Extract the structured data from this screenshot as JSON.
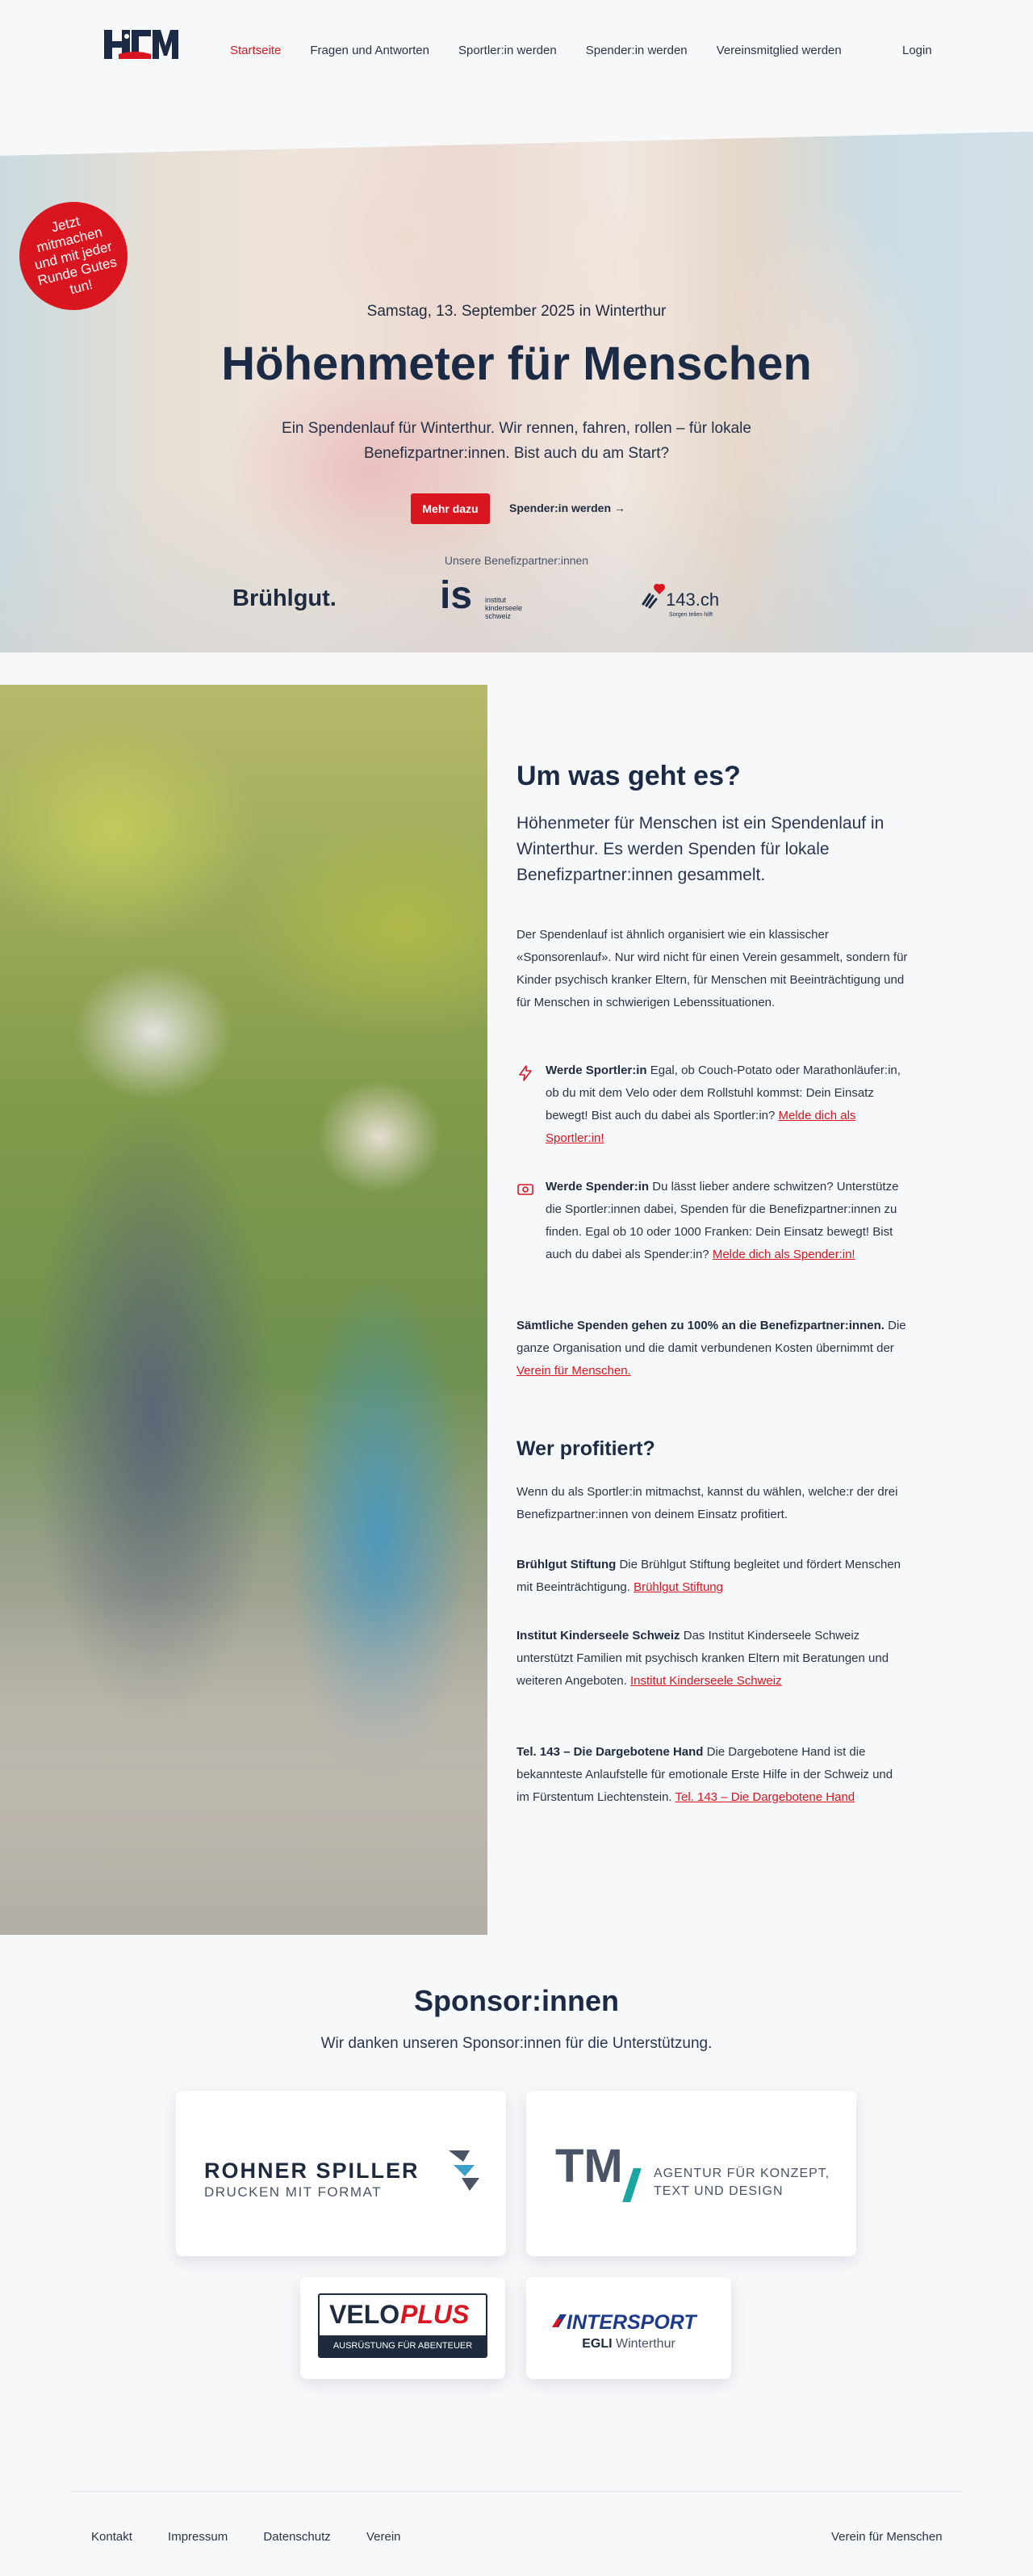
{
  "nav": {
    "logo_alt": "HfM",
    "links": [
      "Startseite",
      "Fragen und Antworten",
      "Sportler:in werden",
      "Spender:in werden",
      "Vereinsmitglied werden"
    ],
    "login": "Login"
  },
  "hero": {
    "badge": "Jetzt mitmachen und mit jeder Runde Gutes tun!",
    "date": "Samstag, 13. September 2025 in Winterthur",
    "title": "Höhenmeter für Menschen",
    "subtitle": "Ein Spendenlauf für Winterthur. Wir rennen, fahren, rollen – für lokale Benefizpartner:innen. Bist auch du am Start?",
    "primary_button": "Mehr dazu",
    "secondary_link": "Spender:in werden →",
    "partners_label": "Unsere Benefizpartner:innen",
    "partner_logos": {
      "bruehlgut": "Brühlgut.",
      "is_letters": "is",
      "is_text": "institut kinderseele schweiz",
      "tel143": "143.ch",
      "tel143_tag": "Sorgen teilen hilft"
    }
  },
  "about": {
    "title": "Um was geht es?",
    "lead": "Höhenmeter für Menschen ist ein Spendenlauf in Winterthur. Es werden Spenden für lokale Benefizpartner:innen gesammelt.",
    "intro": "Der Spendenlauf ist ähnlich organisiert wie ein klassischer «Sponsorenlauf». Nur wird nicht für einen Verein gesammelt, sondern für Kinder psychisch kranker Eltern, für Menschen mit Beeinträchtigung und für Menschen in schwierigen Lebenssituationen.",
    "sportler": {
      "bold": "Werde Sportler:in",
      "text": " Egal, ob Couch-Potato oder Marathonläufer:in, ob du mit dem Velo oder dem Rollstuhl kommst: Dein Einsatz bewegt! Bist auch du dabei als Sportler:in? ",
      "link": "Melde dich als Sportler:in!"
    },
    "spender": {
      "bold": "Werde Spender:in",
      "text": " Du lässt lieber andere schwitzen? Unterstütze die Sportler:innen dabei, Spenden für die Benefizpartner:innen zu finden. Egal ob 10 oder 1000 Franken: Dein Einsatz bewegt! Bist auch du dabei als Spender:in? ",
      "link": "Melde dich als Spender:in!"
    },
    "all_donations": {
      "bold": "Sämtliche Spenden gehen zu 100% an die Benefizpartner:innen.",
      "text": " Die ganze Organisation und die damit verbundenen Kosten übernimmt der ",
      "link": "Verein für Menschen."
    }
  },
  "beneficiaries": {
    "title": "Wer profitiert?",
    "intro": "Wenn du als Sportler:in mitmachst, kannst du wählen, welche:r der drei Benefizpartner:innen von deinem Einsatz profitiert.",
    "items": [
      {
        "bold": "Brühlgut Stiftung",
        "text": " Die Brühlgut Stiftung begleitet und fördert Menschen mit Beeinträchtigung. ",
        "link": "Brühlgut Stiftung"
      },
      {
        "bold": "Institut Kinderseele Schweiz",
        "text": " Das Institut Kinderseele Schweiz unterstützt Familien mit psychisch kranken Eltern mit Beratungen und weiteren Angeboten. ",
        "link": "Institut Kinderseele Schweiz"
      },
      {
        "bold": "Tel. 143 – Die Dargebotene Hand",
        "text": " Die Dargebotene Hand ist die bekannteste Anlaufstelle für emotionale Erste Hilfe in der Schweiz und im Fürstentum Liechtenstein. ",
        "link": "Tel. 143 – Die Dargebotene Hand"
      }
    ]
  },
  "sponsors": {
    "title": "Sponsor:innen",
    "subtitle": "Wir danken unseren Sponsor:innen für die Unterstützung.",
    "rohner": {
      "name": "ROHNER SPILLER",
      "tagline": "DRUCKEN MIT FORMAT"
    },
    "tm": {
      "mark": "TM",
      "line1": "AGENTUR FÜR KONZEPT,",
      "line2": "TEXT UND DESIGN"
    },
    "veloplus": {
      "velo": "VELO",
      "plus": "PLUS",
      "tagline": "AUSRÜSTUNG FÜR ABENTEUER"
    },
    "intersport": {
      "name": "INTERSPORT",
      "sub_bold": "EGLI",
      "sub": " Winterthur"
    }
  },
  "footer": {
    "links": [
      "Kontakt",
      "Impressum",
      "Datenschutz",
      "Verein"
    ],
    "right": "Verein für Menschen"
  },
  "colors": {
    "accent": "#d9161f",
    "navy": "#1c2b45",
    "background": "#f7f8fa"
  }
}
